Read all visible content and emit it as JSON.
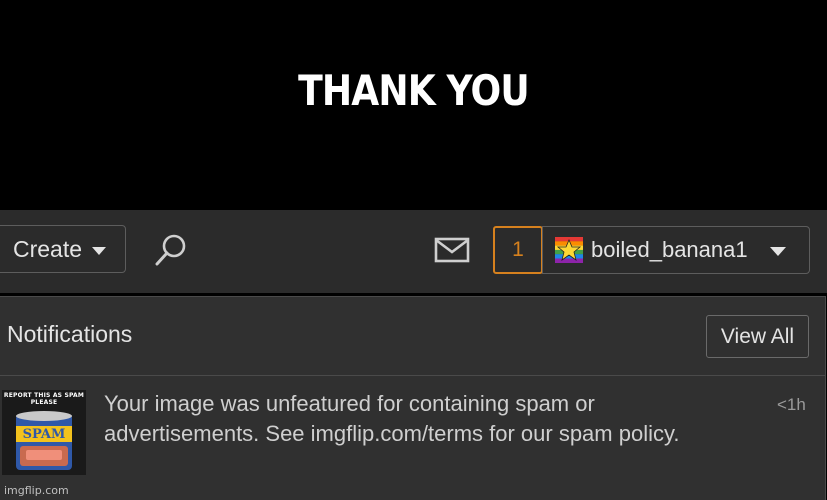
{
  "caption": "THANK YOU",
  "header": {
    "create_label": "Create",
    "notification_count": "1",
    "username": "boiled_banana1"
  },
  "notifications": {
    "title": "Notifications",
    "view_all_label": "View All",
    "items": [
      {
        "thumb_text": "REPORT THIS AS SPAM PLEASE",
        "thumb_label": "SPAM",
        "message": "Your image was unfeatured for containing spam or advertisements. See imgflip.com/terms for our spam policy.",
        "time": "<1h"
      }
    ]
  },
  "watermark": "imgflip.com",
  "colors": {
    "accent": "#d6811e",
    "panel": "#303030",
    "header": "#2b2b2b"
  },
  "icons": {
    "search": "search-icon",
    "mail": "mail-icon",
    "dropdown": "caret-down-icon"
  }
}
